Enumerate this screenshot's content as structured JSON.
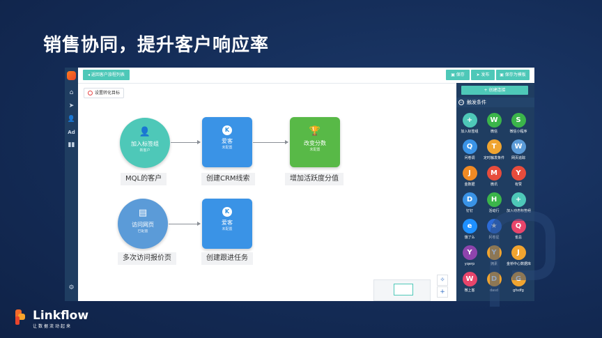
{
  "slide": {
    "title": "销售协同，提升客户响应率"
  },
  "toolbar": {
    "back_label": "返回客户旅程列表",
    "save_label": "保存",
    "publish_label": "发布",
    "save_template_label": "保存为模板",
    "goal_label": "设置转化目标"
  },
  "nodes": [
    {
      "title": "加入标签组",
      "sub": "新客户",
      "label": "MQL的客户",
      "color": "#4ec8b8",
      "icon": "add-user-icon"
    },
    {
      "title": "爱客",
      "sub": "未配置",
      "label": "创建CRM线索",
      "color": "#3a93e6",
      "icon": "k-badge-icon"
    },
    {
      "title": "改变分数",
      "sub": "未配置",
      "label": "增加活跃度分值",
      "color": "#58b947",
      "icon": "trophy-icon"
    },
    {
      "title": "访问网页",
      "sub": "已配置",
      "label": "多次访问报价页",
      "color": "#5b9bd8",
      "icon": "web-page-icon"
    },
    {
      "title": "爱客",
      "sub": "未配置",
      "label": "创建跟进任务",
      "color": "#3a93e6",
      "icon": "k-badge-icon"
    }
  ],
  "panel": {
    "create_label": "+ 创建连接",
    "section_title": "触发条件",
    "triggers": [
      {
        "label": "加入标签组",
        "color": "#4ec8b8",
        "glyph": "+"
      },
      {
        "label": "微信",
        "color": "#3bb54a",
        "glyph": "W"
      },
      {
        "label": "微信小程序",
        "color": "#3bb54a",
        "glyph": "S"
      },
      {
        "label": "问卷调",
        "color": "#3a93e6",
        "glyph": "Q"
      },
      {
        "label": "定时触发条件",
        "color": "#f0a430",
        "glyph": "T"
      },
      {
        "label": "网页追踪",
        "color": "#5b9bd8",
        "glyph": "W"
      },
      {
        "label": "金数据",
        "color": "#f08a24",
        "glyph": "J"
      },
      {
        "label": "微讯",
        "color": "#e74c3c",
        "glyph": "M"
      },
      {
        "label": "有赞",
        "color": "#e74c3c",
        "glyph": "Y"
      },
      {
        "label": "钉钉",
        "color": "#3a93e6",
        "glyph": "D"
      },
      {
        "label": "活动行",
        "color": "#3bb54a",
        "glyph": "H"
      },
      {
        "label": "加入动态标签组",
        "color": "#4ec8b8",
        "glyph": "+"
      },
      {
        "label": "饿了么",
        "color": "#1e90ff",
        "glyph": "e"
      },
      {
        "label": "问卷星",
        "color": "#2d6bd6",
        "glyph": "★"
      },
      {
        "label": "雀总",
        "color": "#e8456b",
        "glyph": "Q"
      },
      {
        "label": "yqerp",
        "color": "#8e44ad",
        "glyph": "Y"
      },
      {
        "label": "拥素",
        "color": "#f0a430",
        "glyph": "Y"
      },
      {
        "label": "金桥中心数据库",
        "color": "#f0a430",
        "glyph": "J"
      },
      {
        "label": "微上客",
        "color": "#e8456b",
        "glyph": "W"
      },
      {
        "label": "dasd",
        "color": "#f0a430",
        "glyph": "D"
      },
      {
        "label": "gfsdfg",
        "color": "#f0a430",
        "glyph": "G"
      }
    ]
  },
  "brand": {
    "name": "Linkflow",
    "tagline": "让数据流动起来"
  }
}
